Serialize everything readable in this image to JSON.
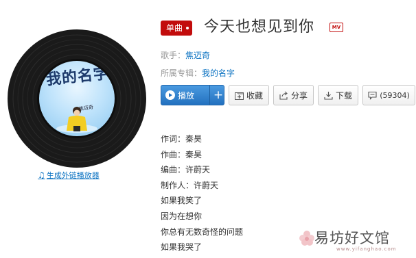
{
  "album_cover": {
    "title_art": "我的名字",
    "signature_art": "焦迈奇"
  },
  "ext_link_label": "生成外链播放器",
  "song": {
    "type_tag": "单曲",
    "title": "今天也想见到你",
    "mv_badge": "MV",
    "singer_label": "歌手：",
    "singer": "焦迈奇",
    "album_label": "所属专辑：",
    "album": "我的名字"
  },
  "actions": {
    "play": "播放",
    "add": "+",
    "favorite": "收藏",
    "share": "分享",
    "download": "下载",
    "comments": "(59304)"
  },
  "lyrics": [
    "作词：秦昊",
    "作曲：秦昊",
    "编曲：许蔚天",
    "制作人：许蔚天",
    "如果我笑了",
    "因为在想你",
    "你总有无数奇怪的问题",
    "如果我哭了"
  ],
  "watermark": {
    "text": "易坊好文馆",
    "url": "www.yifanghao.com"
  },
  "colors": {
    "accent_red": "#c20c0c",
    "link_blue": "#0c73c2",
    "play_blue": "#2371bf"
  }
}
